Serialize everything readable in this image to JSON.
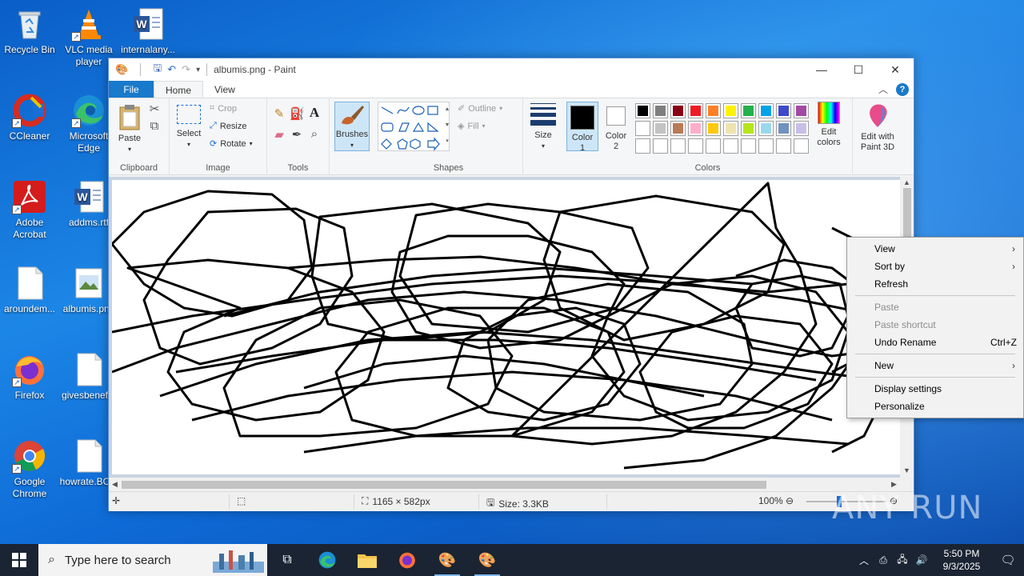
{
  "desktop": {
    "icons": [
      {
        "label": "Recycle Bin"
      },
      {
        "label": "VLC media player"
      },
      {
        "label": "internalany..."
      },
      {
        "label": "CCleaner"
      },
      {
        "label": "Microsoft Edge"
      },
      {
        "label": "Adobe Acrobat"
      },
      {
        "label": "addms.rtf"
      },
      {
        "label": "aroundem..."
      },
      {
        "label": "albumis.png"
      },
      {
        "label": "Firefox"
      },
      {
        "label": "givesbenef..."
      },
      {
        "label": "Google Chrome"
      },
      {
        "label": "howrate.BC..."
      }
    ]
  },
  "paint": {
    "title": "albumis.png - Paint",
    "tabs": {
      "file": "File",
      "home": "Home",
      "view": "View"
    },
    "clipboard": {
      "paste": "Paste",
      "group": "Clipboard"
    },
    "image": {
      "select": "Select",
      "crop": "Crop",
      "resize": "Resize",
      "rotate": "Rotate",
      "group": "Image"
    },
    "tools": {
      "group": "Tools",
      "text_tool": "A"
    },
    "brushes": "Brushes",
    "shapes": {
      "outline": "Outline",
      "fill": "Fill",
      "group": "Shapes"
    },
    "size": "Size",
    "color1": {
      "label": "Color",
      "num": "1"
    },
    "color2": {
      "label": "Color",
      "num": "2"
    },
    "colors": {
      "group": "Colors",
      "edit_label": "Edit",
      "edit_label2": "colors",
      "palette_row1": [
        "#000000",
        "#7f7f7f",
        "#880015",
        "#ed1c24",
        "#ff7f27",
        "#fff200",
        "#22b14c",
        "#00a2e8",
        "#3f48cc",
        "#a349a4"
      ],
      "palette_row2": [
        "#ffffff",
        "#c3c3c3",
        "#b97a57",
        "#ffaec9",
        "#ffc90e",
        "#efe4b0",
        "#b5e61d",
        "#99d9ea",
        "#7092be",
        "#c8bfe7"
      ],
      "palette_row3": [
        "#ffffff",
        "#ffffff",
        "#ffffff",
        "#ffffff",
        "#ffffff",
        "#ffffff",
        "#ffffff",
        "#ffffff",
        "#ffffff",
        "#ffffff"
      ],
      "color1_value": "#000000",
      "color2_value": "#ffffff"
    },
    "paint3d": {
      "line1": "Edit with",
      "line2": "Paint 3D"
    },
    "status": {
      "dimensions": "1165 × 582px",
      "size": "Size: 3.3KB",
      "zoom": "100%"
    }
  },
  "context_menu": {
    "items": [
      {
        "label": "View",
        "submenu": "›"
      },
      {
        "label": "Sort by",
        "submenu": "›"
      },
      {
        "label": "Refresh"
      },
      {
        "label": "Paste"
      },
      {
        "label": "Paste shortcut"
      },
      {
        "label": "Undo Rename",
        "shortcut": "Ctrl+Z"
      },
      {
        "label": "New",
        "submenu": "›"
      },
      {
        "label": "Display settings"
      },
      {
        "label": "Personalize"
      }
    ]
  },
  "taskbar": {
    "search_placeholder": "Type here to search",
    "time": "5:50 PM",
    "date": "9/3/2025"
  },
  "watermark": "ANY RUN"
}
